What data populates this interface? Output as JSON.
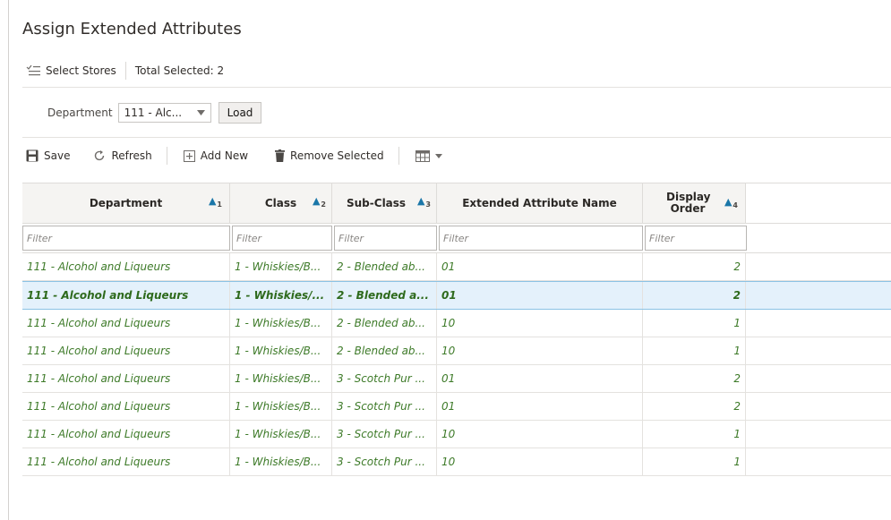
{
  "page": {
    "title": "Assign Extended Attributes"
  },
  "stores": {
    "select_label": "Select Stores",
    "total_selected": "Total Selected: 2"
  },
  "department": {
    "label": "Department",
    "value": "111 - Alc...",
    "load_label": "Load"
  },
  "toolbar": {
    "save_label": "Save",
    "refresh_label": "Refresh",
    "add_new_label": "Add New",
    "remove_selected_label": "Remove Selected",
    "columns_icon": "grid-icon"
  },
  "grid": {
    "columns": [
      {
        "label": "Department",
        "sort": "1"
      },
      {
        "label": "Class",
        "sort": "2"
      },
      {
        "label": "Sub-Class",
        "sort": "3"
      },
      {
        "label": "Extended Attribute Name",
        "sort": ""
      },
      {
        "label": "Display Order",
        "sort": "4"
      }
    ],
    "filter_placeholder": "Filter",
    "rows": [
      {
        "department": "111 - Alcohol and Liqueurs",
        "class": "1 - Whiskies/B...",
        "subclass": "2 - Blended ab...",
        "ext_name": "01",
        "order": "2",
        "selected": false
      },
      {
        "department": "111 - Alcohol and Liqueurs",
        "class": "1 - Whiskies/...",
        "subclass": "2 - Blended a...",
        "ext_name": "01",
        "order": "2",
        "selected": true
      },
      {
        "department": "111 - Alcohol and Liqueurs",
        "class": "1 - Whiskies/B...",
        "subclass": "2 - Blended ab...",
        "ext_name": "10",
        "order": "1",
        "selected": false
      },
      {
        "department": "111 - Alcohol and Liqueurs",
        "class": "1 - Whiskies/B...",
        "subclass": "2 - Blended ab...",
        "ext_name": "10",
        "order": "1",
        "selected": false
      },
      {
        "department": "111 - Alcohol and Liqueurs",
        "class": "1 - Whiskies/B...",
        "subclass": "3 - Scotch Pur ...",
        "ext_name": "01",
        "order": "2",
        "selected": false
      },
      {
        "department": "111 - Alcohol and Liqueurs",
        "class": "1 - Whiskies/B...",
        "subclass": "3 - Scotch Pur ...",
        "ext_name": "01",
        "order": "2",
        "selected": false
      },
      {
        "department": "111 - Alcohol and Liqueurs",
        "class": "1 - Whiskies/B...",
        "subclass": "3 - Scotch Pur ...",
        "ext_name": "10",
        "order": "1",
        "selected": false
      },
      {
        "department": "111 - Alcohol and Liqueurs",
        "class": "1 - Whiskies/B...",
        "subclass": "3 - Scotch Pur ...",
        "ext_name": "10",
        "order": "1",
        "selected": false
      }
    ]
  },
  "colors": {
    "link_green": "#3d7a28",
    "sort_blue": "#1a76a8",
    "selected_bg": "#e4f1fb"
  }
}
